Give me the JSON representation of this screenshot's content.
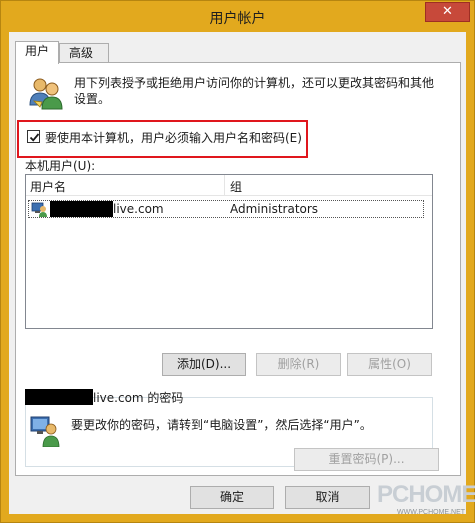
{
  "window": {
    "title": "用户帐户",
    "close_glyph": "✕"
  },
  "tabs": [
    {
      "label": "用户",
      "active": true
    },
    {
      "label": "高级",
      "active": false
    }
  ],
  "description": "用下列表授予或拒绝用户访问你的计算机，还可以更改其密码和其他设置。",
  "require_login": {
    "label": "要使用本计算机，用户必须输入用户名和密码(E)",
    "checked": true
  },
  "local_users": {
    "label": "本机用户(U):",
    "columns": [
      "用户名",
      "组"
    ],
    "rows": [
      {
        "name_suffix": "live.com",
        "group": "Administrators"
      }
    ]
  },
  "buttons": {
    "add": "添加(D)...",
    "remove": "删除(R)",
    "properties": "属性(O)",
    "reset_password": "重置密码(P)...",
    "ok": "确定",
    "cancel": "取消"
  },
  "password_group": {
    "title": "live.com 的密码",
    "text": "要更改你的密码，请转到“电脑设置”，然后选择“用户”。"
  },
  "watermark": {
    "main": "PCHOME",
    "sub": "WWW.PCHOME.NET"
  },
  "colors": {
    "title_bar": "#e2a91e",
    "close_button": "#c7493a",
    "highlight": "#e0161d"
  }
}
